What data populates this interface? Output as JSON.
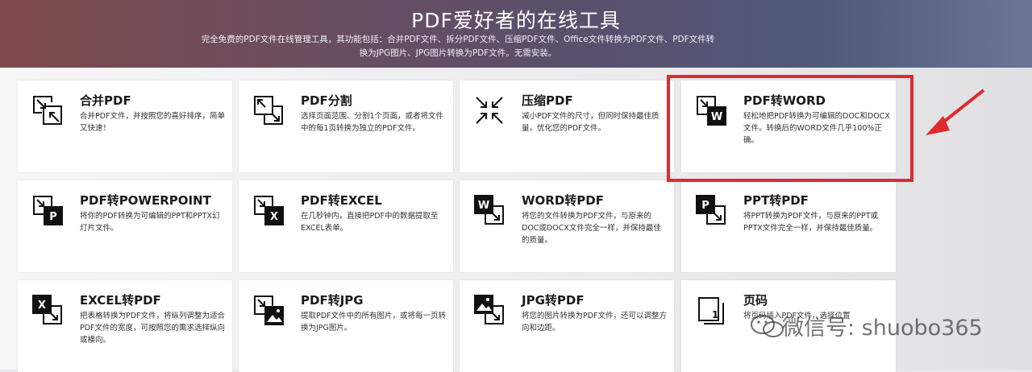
{
  "header": {
    "title": "PDF爱好者的在线工具",
    "subtitle": "完全免费的PDF文件在线管理工具，其功能包括：合并PDF文件、拆分PDF文件、压缩PDF文件、Office文件转换为PDF文件、PDF文件转换为JPG图片、JPG图片转换为PDF文件。无需安装。"
  },
  "tools": [
    {
      "title": "合并PDF",
      "desc": "合并PDF文件，并按照您的喜好排序，简单又快速！",
      "icon": "merge-pdf-icon"
    },
    {
      "title": "PDF分割",
      "desc": "选择页面范围、分割1个页面，或者将文件中的每1页转换为独立的PDF文件。",
      "icon": "split-pdf-icon"
    },
    {
      "title": "压缩PDF",
      "desc": "减小PDF文件的尺寸，但同时保持最佳质量。优化您的PDF文件。",
      "icon": "compress-pdf-icon"
    },
    {
      "title": "PDF转WORD",
      "desc": "轻松地把PDF转换为可编辑的DOC和DOCX文件。转换后的WORD文件几乎100%正确。",
      "icon": "pdf-to-word-icon",
      "glyph": "W"
    },
    {
      "title": "PDF转POWERPOINT",
      "desc": "将你的PDF转换为可编辑的PPT和PPTX幻灯片文件。",
      "icon": "pdf-to-powerpoint-icon",
      "glyph": "P"
    },
    {
      "title": "PDF转EXCEL",
      "desc": "在几秒钟内，直接把PDF中的数据提取至EXCEL表单。",
      "icon": "pdf-to-excel-icon",
      "glyph": "X"
    },
    {
      "title": "WORD转PDF",
      "desc": "将您的文件转换为PDF文件，与原来的DOC或DOCX文件完全一样，并保持最佳的质量。",
      "icon": "word-to-pdf-icon",
      "glyph": "W"
    },
    {
      "title": "PPT转PDF",
      "desc": "将PPT转换为PDF文件，与原来的PPT或PPTX文件完全一样，并保持最佳质量。",
      "icon": "ppt-to-pdf-icon",
      "glyph": "P"
    },
    {
      "title": "EXCEL转PDF",
      "desc": "把表格转换为PDF文件，将纵列调整为适合PDF文件的宽度，可按照您的需求选择纵向或横向。",
      "icon": "excel-to-pdf-icon",
      "glyph": "X"
    },
    {
      "title": "PDF转JPG",
      "desc": "提取PDF文件中的所有图片，或将每一页转换为JPG图片。",
      "icon": "pdf-to-jpg-icon"
    },
    {
      "title": "JPG转PDF",
      "desc": "将您的图片转换为PDF文件，还可以调整方向和边距。",
      "icon": "jpg-to-pdf-icon"
    },
    {
      "title": "页码",
      "desc": "将页码插入PDF文件，选择位置",
      "icon": "page-number-icon",
      "glyph": "1"
    }
  ],
  "watermark": {
    "text": "微信号: shuobo365",
    "icon": "wechat-icon"
  },
  "colors": {
    "highlight": "#e02a2a",
    "card": "#ffffff",
    "text": "#1a1a1a"
  }
}
